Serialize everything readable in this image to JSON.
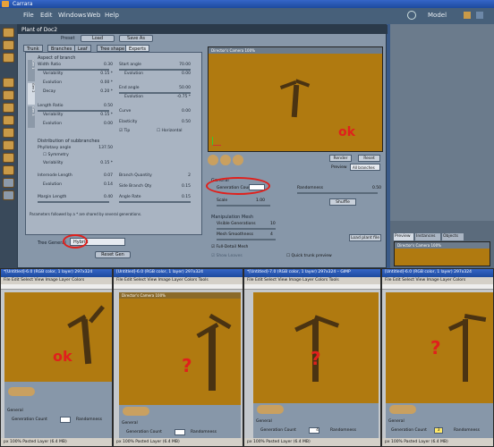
{
  "app": {
    "title": "Carrara",
    "model_label": "Model"
  },
  "menu": [
    "File",
    "Edit",
    "Windows",
    "Web",
    "Help"
  ],
  "dialog": {
    "title": "Plant of Doc2",
    "preset_label": "Preset",
    "load_label": "Load",
    "saveas_label": "Save As",
    "tabs": [
      "Trunk",
      "Branches",
      "Leaf",
      "Tree shape",
      "Experts"
    ],
    "side_tabs": [
      "Gen 1",
      "Gen 2",
      "Gen 3"
    ],
    "aspect_title": "Aspect of branch",
    "left_params": [
      {
        "label": "Width Ratio",
        "value": "0.30"
      },
      {
        "label": "Variability",
        "value": "0.15 *"
      },
      {
        "label": "Evolution",
        "value": "0.00 *"
      },
      {
        "label": "Decay",
        "value": "0.20 *"
      },
      {
        "label": "Length Ratio",
        "value": "0.50"
      },
      {
        "label": "Variability",
        "value": "0.15 *"
      },
      {
        "label": "Evolution",
        "value": "0.00"
      }
    ],
    "right_params": [
      {
        "label": "Start angle",
        "value": "70.00"
      },
      {
        "label": "Evolution",
        "value": "0.00"
      },
      {
        "label": "End angle",
        "value": "50.00"
      },
      {
        "label": "Evolution",
        "value": "-0.75 *"
      },
      {
        "label": "Curve",
        "value": "0.00"
      },
      {
        "label": "Elasticity",
        "value": "0.50"
      }
    ],
    "tip_label": "Tip",
    "horizontal_label": "Horizontal",
    "distribution_title": "Distribution of subbranches",
    "phyllotaxy": {
      "label": "Phyllotaxy angle",
      "value": "137.50"
    },
    "symmetry_label": "Symmetry",
    "dist_left": [
      {
        "label": "Variability",
        "value": "0.15 *"
      },
      {
        "label": "Internode Length",
        "value": "0.07"
      },
      {
        "label": "Evolution",
        "value": "0.14"
      },
      {
        "label": "Margin Length",
        "value": "0.40"
      }
    ],
    "dist_right": [
      {
        "label": "Branch Quantity",
        "value": "2"
      },
      {
        "label": "Side Branch Qty",
        "value": "0.15"
      },
      {
        "label": "Angle Rate",
        "value": "0.15"
      }
    ],
    "footnote": "Parameters followed by a * are shared by several generations.",
    "tree_general_label": "Tree General",
    "tree_general_value": "Hybrid",
    "reset_label": "Reset Gen",
    "viewport_title": "Director's Camera 100%",
    "render_label": "Render",
    "reset_btn_label": "Reset",
    "preview_label": "Preview",
    "preview_value": "All branches",
    "general_title": "General",
    "generation_count_label": "Generation Count",
    "randomness_label": "Randomness",
    "randomness_value": "0.50",
    "scale_label": "Scale",
    "scale_value": "1.00",
    "shuffle_label": "Shuffle",
    "manip_title": "Manipulation Mesh",
    "visible_generations_label": "Visible Generations",
    "visible_generations_value": "10",
    "mesh_smoothness_label": "Mesh Smoothness",
    "mesh_smoothness_value": "4",
    "full_detail_label": "Full-Detail Mesh",
    "show_leaves_label": "Show Leaves",
    "quick_preview_label": "Quick trunk preview",
    "load_plant_label": "Load plant file"
  },
  "right_panel": {
    "tabs": [
      "Preview",
      "Instances",
      "Objects"
    ],
    "viewport_title": "Director's Camera 100%"
  },
  "shots": [
    {
      "title": "*[Untitled]-6.0 (RGB color, 1 layer) 297x324",
      "annotation": "ok",
      "gen_count": ""
    },
    {
      "title": "[Untitled]-6.0 (RGB color, 1 layer) 297x324",
      "annotation": "?",
      "gen_count": ""
    },
    {
      "title": "*[Untitled]-7.0 (RGB color, 1 layer) 297x324 – GIMP",
      "annotation": "?",
      "gen_count": "4"
    },
    {
      "title": "[Untitled]-6.0 (RGB color, 1 layer) 297x324",
      "annotation": "?",
      "gen_count": "3"
    }
  ],
  "gimp_menu": [
    "File",
    "Edit",
    "Select",
    "View",
    "Image",
    "Layer",
    "Colors",
    "Tools"
  ],
  "shot_status": {
    "unit": "px",
    "zoom": "100%",
    "layer": "Pasted Layer (6.4 MB)"
  },
  "annotations": {
    "top_ok": "ok",
    "left_ok": "ok"
  }
}
